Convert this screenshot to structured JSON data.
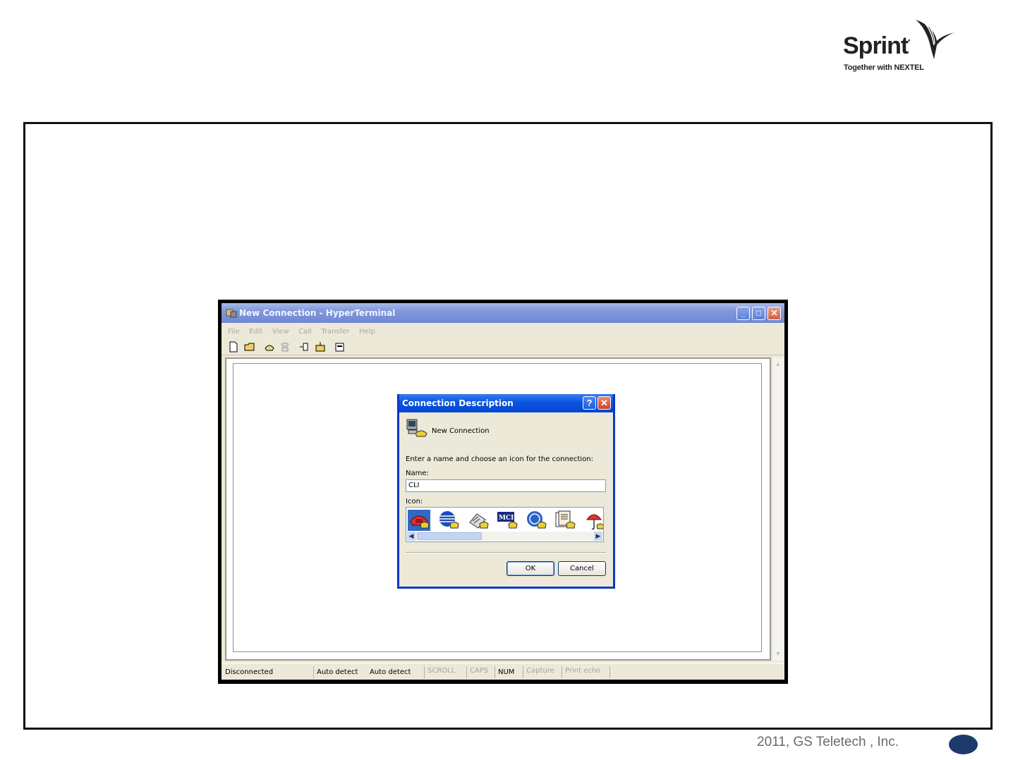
{
  "brand": {
    "logo_word": "Sprint",
    "logo_tagline": "Together with NEXTEL",
    "color_text": "#222222"
  },
  "window": {
    "title": "New Connection - HyperTerminal",
    "menu": [
      "File",
      "Edit",
      "View",
      "Call",
      "Transfer",
      "Help"
    ],
    "toolbar_icons": [
      "new-icon",
      "open-icon",
      "connect-icon",
      "disconnect-icon",
      "send-icon",
      "receive-icon",
      "properties-icon"
    ],
    "status": {
      "connection": "Disconnected",
      "detect1": "Auto detect",
      "detect2": "Auto detect",
      "scroll": "SCROLL",
      "caps": "CAPS",
      "num": "NUM",
      "capture": "Capture",
      "print_echo": "Print echo"
    }
  },
  "dialog": {
    "title": "Connection Description",
    "help_label": "?",
    "heading": "New Connection",
    "instruction": "Enter a name and choose an icon for the connection:",
    "name_label": "Name:",
    "name_value": "CLI",
    "icon_label": "Icon:",
    "icons": [
      "phone-icon",
      "globe-icon",
      "fax-icon",
      "mci-icon",
      "at-icon",
      "document-icon",
      "umbrella-icon"
    ],
    "selected_icon": "phone-icon",
    "ok_label": "OK",
    "cancel_label": "Cancel"
  },
  "footer": {
    "copyright": "2011, GS Teletech , Inc.",
    "page_dot_color": "#1d3a6d"
  }
}
